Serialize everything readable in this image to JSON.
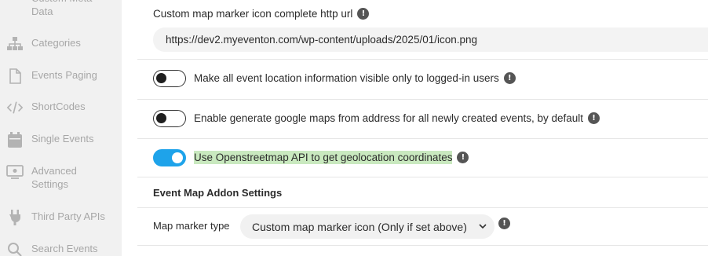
{
  "sidebar": {
    "items": [
      {
        "label": "Custom Meta Data",
        "icon": "custom-meta-icon"
      },
      {
        "label": "Categories",
        "icon": "sitemap-icon"
      },
      {
        "label": "Events Paging",
        "icon": "file-icon"
      },
      {
        "label": "ShortCodes",
        "icon": "code-icon"
      },
      {
        "label": "Single Events",
        "icon": "calendar-icon"
      },
      {
        "label": "Advanced Settings",
        "icon": "monitor-icon"
      },
      {
        "label": "Third Party APIs",
        "icon": "plug-icon"
      },
      {
        "label": "Search Events",
        "icon": "search-icon"
      }
    ]
  },
  "main": {
    "marker_url": {
      "label": "Custom map marker icon complete http url",
      "value": "https://dev2.myeventon.com/wp-content/uploads/2025/01/icon.png"
    },
    "toggles": [
      {
        "label": "Make all event location information visible only to logged-in users",
        "state": "off"
      },
      {
        "label": "Enable generate google maps from address for all newly created events, by default",
        "state": "off"
      },
      {
        "label": "Use Openstreetmap API to get geolocation coordinates",
        "state": "on"
      }
    ],
    "section_title": "Event Map Addon Settings",
    "marker_type": {
      "label": "Map marker type",
      "selected": "Custom map marker icon (Only if set above)"
    },
    "info_glyph": "!"
  },
  "colors": {
    "sidebar_bg": "#f1f1f1",
    "sidebar_text": "#a7a7a7",
    "toggle_on": "#1ea3ea",
    "highlight": "#c9e9bf",
    "info_bg": "#555555"
  }
}
